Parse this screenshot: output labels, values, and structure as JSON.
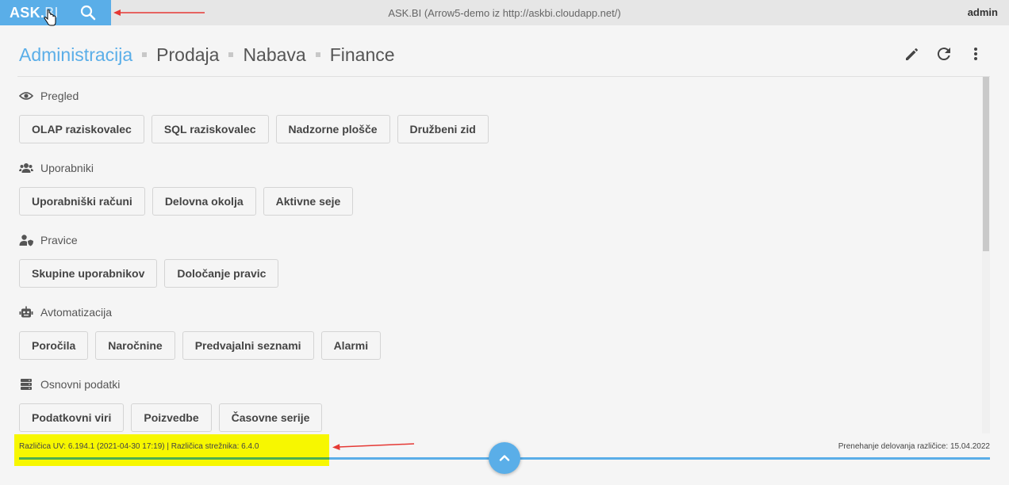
{
  "topbar": {
    "logo_main": "ASK.",
    "logo_dim": "BI",
    "title": "ASK.BI (Arrow5-demo iz http://askbi.cloudapp.net/)",
    "user": "admin"
  },
  "tabs": [
    {
      "label": "Administracija",
      "active": true
    },
    {
      "label": "Prodaja",
      "active": false
    },
    {
      "label": "Nabava",
      "active": false
    },
    {
      "label": "Finance",
      "active": false
    }
  ],
  "tools": [
    "edit-icon",
    "refresh-icon",
    "more-vert-icon"
  ],
  "sections": [
    {
      "title": "Pregled",
      "icon": "eye-icon",
      "buttons": [
        "OLAP raziskovalec",
        "SQL raziskovalec",
        "Nadzorne plošče",
        "Družbeni zid"
      ]
    },
    {
      "title": "Uporabniki",
      "icon": "users-icon",
      "buttons": [
        "Uporabniški računi",
        "Delovna okolja",
        "Aktivne seje"
      ]
    },
    {
      "title": "Pravice",
      "icon": "user-shield-icon",
      "buttons": [
        "Skupine uporabnikov",
        "Določanje pravic"
      ]
    },
    {
      "title": "Avtomatizacija",
      "icon": "robot-icon",
      "buttons": [
        "Poročila",
        "Naročnine",
        "Predvajalni seznami",
        "Alarmi"
      ]
    },
    {
      "title": "Osnovni podatki",
      "icon": "database-icon",
      "buttons": [
        "Podatkovni viri",
        "Poizvedbe",
        "Časovne serije"
      ]
    }
  ],
  "footer": {
    "version_text": "Različica UV: 6.194.1 (2021-04-30 17:19) | Različica strežnika: 6.4.0",
    "support_text": "Prenehanje delovanja različice: 15.04.2022"
  },
  "colors": {
    "accent": "#5aaee8",
    "highlight": "#f7f700",
    "annotation_arrow": "#e53935",
    "progress_green": "#4caf50"
  }
}
